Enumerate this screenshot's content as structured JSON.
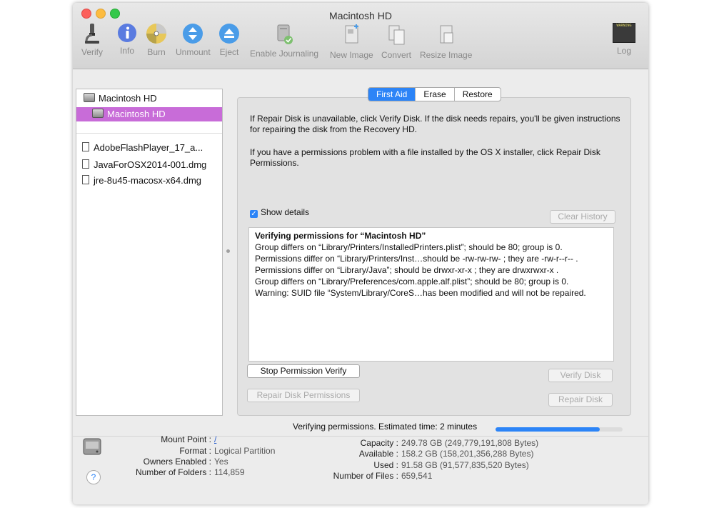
{
  "window": {
    "title": "Macintosh HD"
  },
  "toolbar": {
    "verify": "Verify",
    "info": "Info",
    "burn": "Burn",
    "unmount": "Unmount",
    "eject": "Eject",
    "enable_journaling": "Enable Journaling",
    "new_image": "New Image",
    "convert": "Convert",
    "resize_image": "Resize Image",
    "log": "Log",
    "log_icon_text": "WARNING"
  },
  "sidebar": {
    "items": [
      {
        "label": "Macintosh HD"
      },
      {
        "label": "Macintosh HD"
      },
      {
        "label": "AdobeFlashPlayer_17_a..."
      },
      {
        "label": "JavaForOSX2014-001.dmg"
      },
      {
        "label": "jre-8u45-macosx-x64.dmg"
      }
    ]
  },
  "tabs": [
    {
      "label": "First Aid"
    },
    {
      "label": "Erase"
    },
    {
      "label": "Restore"
    }
  ],
  "first_aid": {
    "para1": "If Repair Disk is unavailable, click Verify Disk. If the disk needs repairs, you'll be given instructions for repairing the disk from the Recovery HD.",
    "para2": "If you have a permissions problem with a file installed by the OS X installer, click Repair Disk Permissions.",
    "show_details": "Show details",
    "clear_history": "Clear History",
    "log_title": "Verifying permissions for “Macintosh HD”",
    "log_lines": [
      "Group differs on “Library/Printers/InstalledPrinters.plist”; should be 80; group is 0.",
      "Permissions differ on “Library/Printers/Inst…should be -rw-rw-rw- ; they are -rw-r--r-- .",
      "Permissions differ on “Library/Java”; should be drwxr-xr-x ; they are drwxrwxr-x .",
      "Group differs on “Library/Preferences/com.apple.alf.plist”; should be 80; group is 0.",
      "Warning: SUID file “System/Library/CoreS…has been modified and will not be repaired."
    ],
    "stop_button": "Stop Permission Verify",
    "verify_disk": "Verify Disk",
    "repair_permissions": "Repair Disk Permissions",
    "repair_disk": "Repair Disk"
  },
  "status": {
    "text": "Verifying permissions. Estimated time: 2 minutes",
    "progress": 0.82
  },
  "info_left": [
    {
      "label": "Mount Point :",
      "value": "/"
    },
    {
      "label": "Format :",
      "value": "Logical Partition"
    },
    {
      "label": "Owners Enabled :",
      "value": "Yes"
    },
    {
      "label": "Number of Folders :",
      "value": "114,859"
    }
  ],
  "info_right": [
    {
      "label": "Capacity :",
      "value": "249.78 GB (249,779,191,808 Bytes)"
    },
    {
      "label": "Available :",
      "value": "158.2 GB (158,201,356,288 Bytes)"
    },
    {
      "label": "Used :",
      "value": "91.58 GB (91,577,835,520 Bytes)"
    },
    {
      "label": "Number of Files :",
      "value": "659,541"
    }
  ],
  "help": "?",
  "colors": {
    "accent": "#2c84f7",
    "selection": "#c86cd8"
  }
}
